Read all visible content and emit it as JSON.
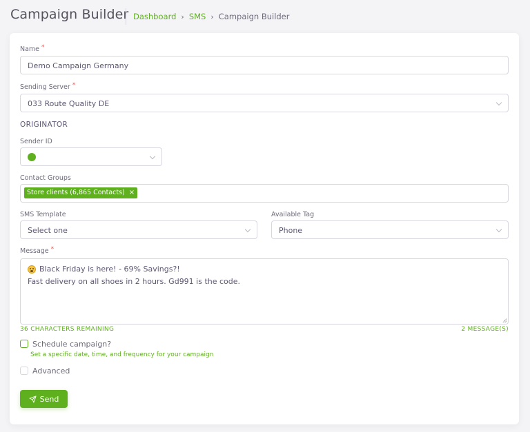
{
  "header": {
    "title": "Campaign Builder",
    "breadcrumb": [
      "Dashboard",
      "SMS",
      "Campaign Builder"
    ]
  },
  "form": {
    "name": {
      "label": "Name",
      "value": "Demo Campaign Germany"
    },
    "sending_server": {
      "label": "Sending Server",
      "value": "033 Route Quality DE"
    },
    "section_originator": "ORIGINATOR",
    "sender_id": {
      "label": "Sender ID"
    },
    "contact_groups": {
      "label": "Contact Groups",
      "tag": "Store clients (6,865 Contacts)",
      "tag_remove": "×"
    },
    "sms_template": {
      "label": "SMS Template",
      "value": "Select one"
    },
    "available_tag": {
      "label": "Available Tag",
      "value": "Phone"
    },
    "message": {
      "label": "Message",
      "line1": "Black Friday is here! - 69% Savings?!",
      "line2": "Fast delivery on all shoes in 2 hours. Gd991 is the code."
    },
    "chars_remaining": "36 CHARACTERS REMAINING",
    "message_count": "2 MESSAGE(S)",
    "schedule": {
      "label": "Schedule campaign?",
      "hint": "Set a specific date, time, and frequency for your campaign"
    },
    "advanced": {
      "label": "Advanced"
    },
    "send_label": "Send",
    "required_mark": "*"
  },
  "colors": {
    "accent": "#5fb01f",
    "required": "#ea5455"
  }
}
